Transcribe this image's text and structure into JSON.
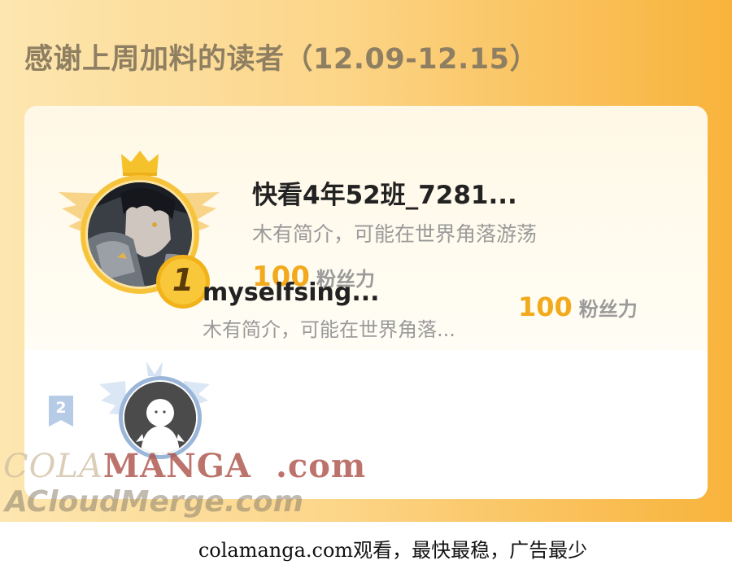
{
  "header": {
    "title": "感谢上周加料的读者（12.09-12.15）"
  },
  "ranking": [
    {
      "rank": "1",
      "name": "快看4年52班_7281...",
      "bio": "木有简介，可能在世界角落游荡",
      "fans_count": "100",
      "fans_unit": "粉丝力"
    },
    {
      "rank": "2",
      "name": "myselfsing...",
      "bio": "木有简介，可能在世界角落...",
      "fans_count": "100",
      "fans_unit": "粉丝力"
    }
  ],
  "watermark": {
    "line1_part1": "COLA",
    "line1_part2": "MANGA",
    "line1_part3": ".com",
    "line2": "ACloudMerge.com"
  },
  "footer": {
    "text": "colamanga.com观看，最快最稳，广告最少"
  },
  "colors": {
    "accent": "#f2a91c",
    "gold": "#f5c518",
    "silver": "#9bb6d8"
  },
  "icons": {
    "crown": "crown-icon",
    "rank1_badge": "rank-1-badge-icon",
    "rank2_badge": "rank-2-badge-icon",
    "wings": "wings-icon",
    "default_avatar": "default-avatar-icon"
  }
}
